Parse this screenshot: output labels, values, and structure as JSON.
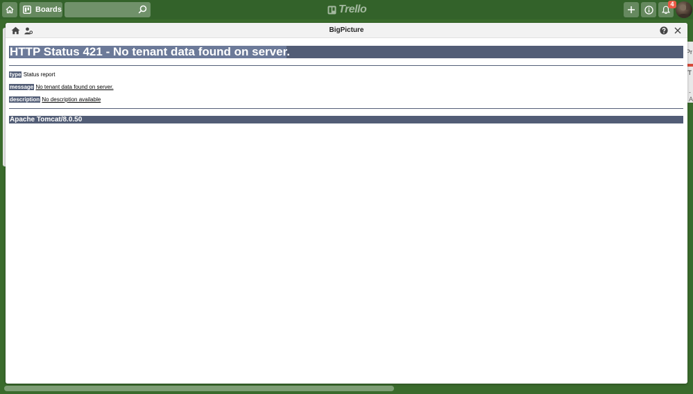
{
  "header": {
    "boards_label": "Boards",
    "search_placeholder": "",
    "logo_text": "Trello",
    "notification_count": "4"
  },
  "background_peek": {
    "text1": "Pr",
    "text2": "/T",
    "text3": "- A"
  },
  "modal": {
    "title": "BigPicture"
  },
  "error_page": {
    "heading_prefix": "HTTP Status 421 - No tenant data found on server",
    "heading_suffix": ".",
    "type_label": "type",
    "type_value": "Status report",
    "message_label": "message",
    "message_value": "No tenant data found on server.",
    "description_label": "description",
    "description_value": "No description available",
    "server": "Apache Tomcat/8.0.50"
  },
  "colors": {
    "trello_green": "#3a6b2c",
    "tomcat_blue": "#525d76",
    "badge_red": "#eb5a46"
  }
}
